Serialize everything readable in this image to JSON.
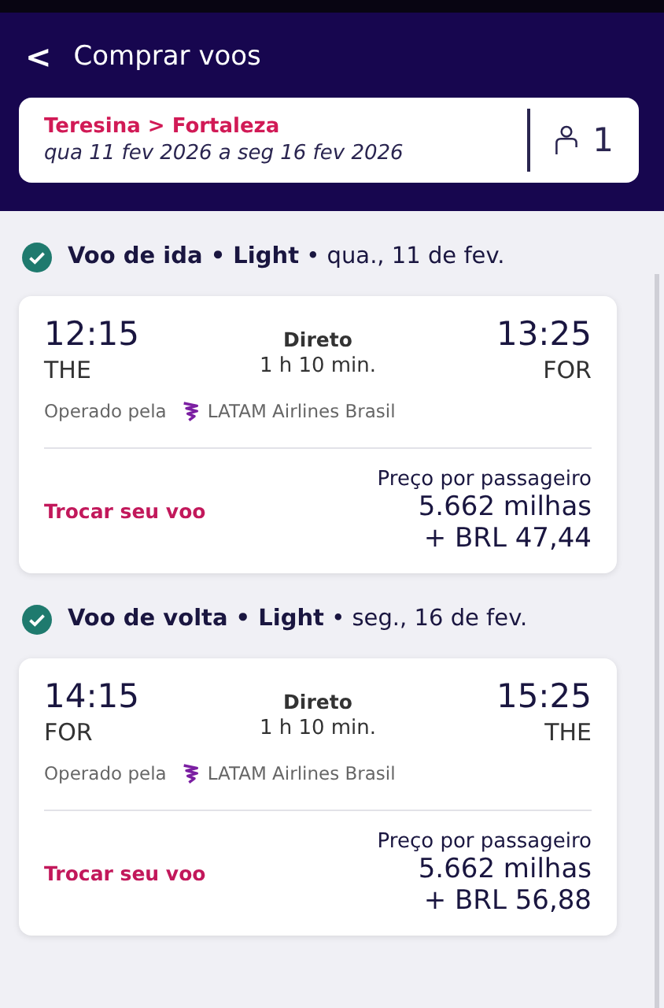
{
  "header": {
    "back": "<",
    "title": "Comprar voos"
  },
  "search_summary": {
    "route": "Teresina > Fortaleza",
    "dates": "qua 11 fev 2026 a seg 16 fev 2026",
    "passengers": "1"
  },
  "flights": [
    {
      "heading": "**Voo de ida • Light** • qua., 11 de fev.",
      "depart_time": "12:15",
      "depart_airport": "THE",
      "stops": "Direto",
      "duration": "1 h 10 min.",
      "arrive_time": "13:25",
      "arrive_airport": "FOR",
      "operated_label": "Operado pela",
      "airline": "LATAM Airlines Brasil",
      "change_link": "Trocar seu voo",
      "price_label": "Preço por passageiro",
      "miles": "5.662 milhas",
      "cash": "+ BRL 47,44"
    },
    {
      "heading": "**Voo de volta • Light** • seg., 16 de fev.",
      "depart_time": "14:15",
      "depart_airport": "FOR",
      "stops": "Direto",
      "duration": "1 h 10 min.",
      "arrive_time": "15:25",
      "arrive_airport": "THE",
      "operated_label": "Operado pela",
      "airline": "LATAM Airlines Brasil",
      "change_link": "Trocar seu voo",
      "price_label": "Preço por passageiro",
      "miles": "5.662 milhas",
      "cash": "+ BRL 56,88"
    }
  ]
}
